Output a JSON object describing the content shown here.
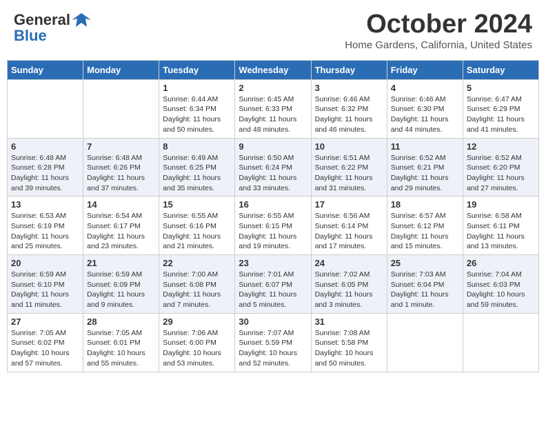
{
  "header": {
    "logo_general": "General",
    "logo_blue": "Blue",
    "month_title": "October 2024",
    "location": "Home Gardens, California, United States"
  },
  "days_of_week": [
    "Sunday",
    "Monday",
    "Tuesday",
    "Wednesday",
    "Thursday",
    "Friday",
    "Saturday"
  ],
  "weeks": [
    [
      {
        "day": "",
        "info": ""
      },
      {
        "day": "",
        "info": ""
      },
      {
        "day": "1",
        "info": "Sunrise: 6:44 AM\nSunset: 6:34 PM\nDaylight: 11 hours and 50 minutes."
      },
      {
        "day": "2",
        "info": "Sunrise: 6:45 AM\nSunset: 6:33 PM\nDaylight: 11 hours and 48 minutes."
      },
      {
        "day": "3",
        "info": "Sunrise: 6:46 AM\nSunset: 6:32 PM\nDaylight: 11 hours and 46 minutes."
      },
      {
        "day": "4",
        "info": "Sunrise: 6:46 AM\nSunset: 6:30 PM\nDaylight: 11 hours and 44 minutes."
      },
      {
        "day": "5",
        "info": "Sunrise: 6:47 AM\nSunset: 6:29 PM\nDaylight: 11 hours and 41 minutes."
      }
    ],
    [
      {
        "day": "6",
        "info": "Sunrise: 6:48 AM\nSunset: 6:28 PM\nDaylight: 11 hours and 39 minutes."
      },
      {
        "day": "7",
        "info": "Sunrise: 6:48 AM\nSunset: 6:26 PM\nDaylight: 11 hours and 37 minutes."
      },
      {
        "day": "8",
        "info": "Sunrise: 6:49 AM\nSunset: 6:25 PM\nDaylight: 11 hours and 35 minutes."
      },
      {
        "day": "9",
        "info": "Sunrise: 6:50 AM\nSunset: 6:24 PM\nDaylight: 11 hours and 33 minutes."
      },
      {
        "day": "10",
        "info": "Sunrise: 6:51 AM\nSunset: 6:22 PM\nDaylight: 11 hours and 31 minutes."
      },
      {
        "day": "11",
        "info": "Sunrise: 6:52 AM\nSunset: 6:21 PM\nDaylight: 11 hours and 29 minutes."
      },
      {
        "day": "12",
        "info": "Sunrise: 6:52 AM\nSunset: 6:20 PM\nDaylight: 11 hours and 27 minutes."
      }
    ],
    [
      {
        "day": "13",
        "info": "Sunrise: 6:53 AM\nSunset: 6:19 PM\nDaylight: 11 hours and 25 minutes."
      },
      {
        "day": "14",
        "info": "Sunrise: 6:54 AM\nSunset: 6:17 PM\nDaylight: 11 hours and 23 minutes."
      },
      {
        "day": "15",
        "info": "Sunrise: 6:55 AM\nSunset: 6:16 PM\nDaylight: 11 hours and 21 minutes."
      },
      {
        "day": "16",
        "info": "Sunrise: 6:55 AM\nSunset: 6:15 PM\nDaylight: 11 hours and 19 minutes."
      },
      {
        "day": "17",
        "info": "Sunrise: 6:56 AM\nSunset: 6:14 PM\nDaylight: 11 hours and 17 minutes."
      },
      {
        "day": "18",
        "info": "Sunrise: 6:57 AM\nSunset: 6:12 PM\nDaylight: 11 hours and 15 minutes."
      },
      {
        "day": "19",
        "info": "Sunrise: 6:58 AM\nSunset: 6:11 PM\nDaylight: 11 hours and 13 minutes."
      }
    ],
    [
      {
        "day": "20",
        "info": "Sunrise: 6:59 AM\nSunset: 6:10 PM\nDaylight: 11 hours and 11 minutes."
      },
      {
        "day": "21",
        "info": "Sunrise: 6:59 AM\nSunset: 6:09 PM\nDaylight: 11 hours and 9 minutes."
      },
      {
        "day": "22",
        "info": "Sunrise: 7:00 AM\nSunset: 6:08 PM\nDaylight: 11 hours and 7 minutes."
      },
      {
        "day": "23",
        "info": "Sunrise: 7:01 AM\nSunset: 6:07 PM\nDaylight: 11 hours and 5 minutes."
      },
      {
        "day": "24",
        "info": "Sunrise: 7:02 AM\nSunset: 6:05 PM\nDaylight: 11 hours and 3 minutes."
      },
      {
        "day": "25",
        "info": "Sunrise: 7:03 AM\nSunset: 6:04 PM\nDaylight: 11 hours and 1 minute."
      },
      {
        "day": "26",
        "info": "Sunrise: 7:04 AM\nSunset: 6:03 PM\nDaylight: 10 hours and 59 minutes."
      }
    ],
    [
      {
        "day": "27",
        "info": "Sunrise: 7:05 AM\nSunset: 6:02 PM\nDaylight: 10 hours and 57 minutes."
      },
      {
        "day": "28",
        "info": "Sunrise: 7:05 AM\nSunset: 6:01 PM\nDaylight: 10 hours and 55 minutes."
      },
      {
        "day": "29",
        "info": "Sunrise: 7:06 AM\nSunset: 6:00 PM\nDaylight: 10 hours and 53 minutes."
      },
      {
        "day": "30",
        "info": "Sunrise: 7:07 AM\nSunset: 5:59 PM\nDaylight: 10 hours and 52 minutes."
      },
      {
        "day": "31",
        "info": "Sunrise: 7:08 AM\nSunset: 5:58 PM\nDaylight: 10 hours and 50 minutes."
      },
      {
        "day": "",
        "info": ""
      },
      {
        "day": "",
        "info": ""
      }
    ]
  ]
}
